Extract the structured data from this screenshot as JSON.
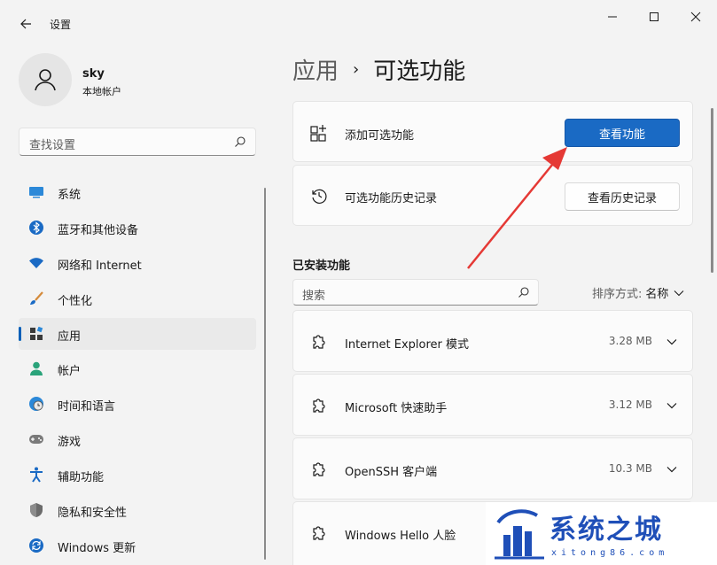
{
  "window": {
    "title": "设置"
  },
  "user": {
    "name": "sky",
    "account_type": "本地帐户"
  },
  "sidebar": {
    "search_placeholder": "查找设置",
    "items": [
      {
        "label": "系统",
        "icon": "system-icon"
      },
      {
        "label": "蓝牙和其他设备",
        "icon": "bluetooth-icon"
      },
      {
        "label": "网络和 Internet",
        "icon": "wifi-icon"
      },
      {
        "label": "个性化",
        "icon": "brush-icon"
      },
      {
        "label": "应用",
        "icon": "apps-icon",
        "active": true
      },
      {
        "label": "帐户",
        "icon": "person-icon"
      },
      {
        "label": "时间和语言",
        "icon": "globe-clock-icon"
      },
      {
        "label": "游戏",
        "icon": "gamepad-icon"
      },
      {
        "label": "辅助功能",
        "icon": "accessibility-icon"
      },
      {
        "label": "隐私和安全性",
        "icon": "shield-icon"
      },
      {
        "label": "Windows 更新",
        "icon": "update-icon"
      }
    ]
  },
  "breadcrumb": {
    "parent": "应用",
    "separator": "›",
    "current": "可选功能"
  },
  "cards": {
    "add": {
      "label": "添加可选功能",
      "button": "查看功能"
    },
    "history": {
      "label": "可选功能历史记录",
      "button": "查看历史记录"
    }
  },
  "installed": {
    "title": "已安装功能",
    "search_placeholder": "搜索",
    "sort_label": "排序方式:",
    "sort_value": "名称",
    "features": [
      {
        "name": "Internet Explorer 模式",
        "size": "3.28 MB"
      },
      {
        "name": "Microsoft 快速助手",
        "size": "3.12 MB"
      },
      {
        "name": "OpenSSH 客户端",
        "size": "10.3 MB"
      },
      {
        "name": "Windows Hello 人脸",
        "size": ""
      }
    ]
  },
  "watermark": {
    "text": "系统之城",
    "sub": "xitong86.com"
  },
  "colors": {
    "accent": "#005fb8",
    "primary_button": "#1a6ac4",
    "annotation_arrow": "#e53935",
    "watermark": "#1f4fb8"
  }
}
